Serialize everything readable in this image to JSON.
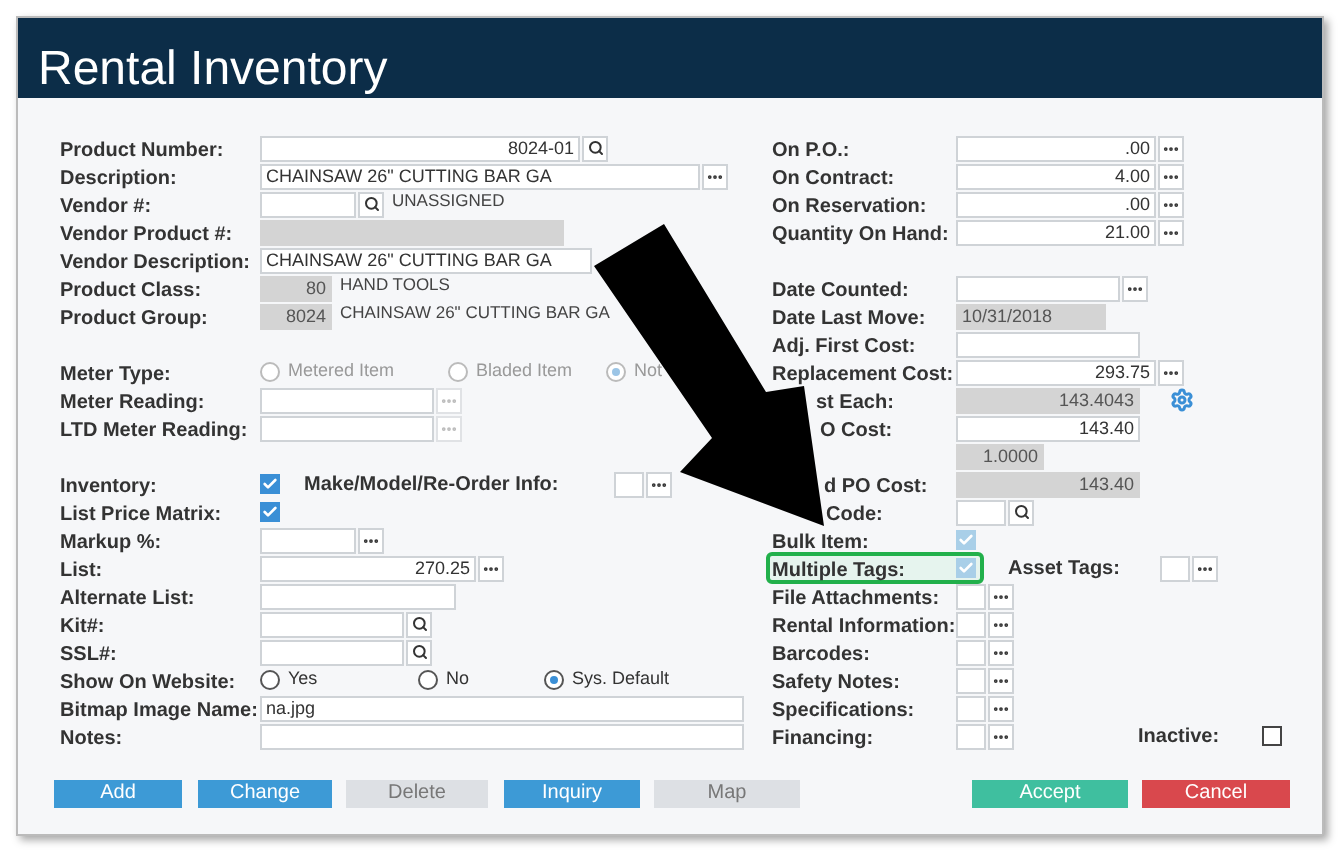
{
  "window": {
    "title": "Rental Inventory"
  },
  "left_sections": [
    [
      {
        "label": "Product Number:",
        "kind": "field",
        "value": "8024-01",
        "numeric": true,
        "button": {
          "kind": "search"
        }
      },
      {
        "label": "Description:",
        "kind": "field",
        "value": "CHAINSAW 26\"  CUTTING BAR GA",
        "button": {
          "kind": "more"
        }
      },
      {
        "label": "Vendor #:",
        "kind": "field",
        "button": {
          "kind": "search"
        },
        "note": "UNASSIGNED"
      },
      {
        "label": "Vendor Product #:",
        "kind": "field",
        "readonly": true
      },
      {
        "label": "Vendor Description:",
        "kind": "field",
        "value": "CHAINSAW 26\"  CUTTING BAR GA"
      },
      {
        "label": "Product Class:",
        "kind": "field",
        "value": "80",
        "numeric": true,
        "readonly": true,
        "note": "HAND TOOLS"
      },
      {
        "label": "Product Group:",
        "kind": "field",
        "value": "8024",
        "numeric": true,
        "readonly": true,
        "note": "CHAINSAW 26\" CUTTING BAR GA"
      }
    ],
    [
      {
        "label": "Meter Type:",
        "kind": "radio",
        "options": [
          {
            "label": "Metered Item",
            "selected": false,
            "disabled": true
          },
          {
            "label": "Bladed Item",
            "selected": false,
            "disabled": true
          },
          {
            "label": "Not",
            "selected": true,
            "disabled": true
          }
        ]
      },
      {
        "label": "Meter Reading:",
        "kind": "field",
        "button": {
          "kind": "more_disabled"
        }
      },
      {
        "label": "LTD Meter Reading:",
        "kind": "field",
        "button": {
          "kind": "more_disabled"
        }
      }
    ],
    [
      {
        "label": "Inventory:",
        "kind": "checkbox",
        "checked": true,
        "disabled": false,
        "extra": {
          "label": "Make/Model/Re-Order Info:",
          "kind": "field",
          "button": {
            "kind": "more"
          }
        }
      },
      {
        "label": "List Price Matrix:",
        "kind": "checkbox",
        "checked": true,
        "disabled": false
      },
      {
        "label": "Markup %:",
        "kind": "field",
        "button": {
          "kind": "more"
        }
      },
      {
        "label": "List:",
        "kind": "field",
        "value": "270.25",
        "numeric": true,
        "button": {
          "kind": "more"
        }
      },
      {
        "label": "Alternate List:",
        "kind": "field"
      },
      {
        "label": "Kit#:",
        "kind": "field",
        "button": {
          "kind": "search"
        }
      },
      {
        "label": "SSL#:",
        "kind": "field",
        "button": {
          "kind": "search"
        }
      },
      {
        "label": "Show On Website:",
        "kind": "radio",
        "options": [
          {
            "label": "Yes",
            "selected": false,
            "disabled": false
          },
          {
            "label": "No",
            "selected": false,
            "disabled": false
          },
          {
            "label": "Sys. Default",
            "selected": true,
            "disabled": false
          }
        ]
      },
      {
        "label": "Bitmap Image Name:",
        "kind": "field",
        "value": "na.jpg"
      },
      {
        "label": "Notes:",
        "kind": "field"
      }
    ]
  ],
  "right_sections": [
    [
      {
        "label": "On P.O.:",
        "kind": "field",
        "value": ".00",
        "numeric": true,
        "button": {
          "kind": "more"
        }
      },
      {
        "label": "On Contract:",
        "kind": "field",
        "value": "4.00",
        "numeric": true,
        "button": {
          "kind": "more"
        }
      },
      {
        "label": "On Reservation:",
        "kind": "field",
        "value": ".00",
        "numeric": true,
        "button": {
          "kind": "more"
        }
      },
      {
        "label": "Quantity On Hand:",
        "kind": "field",
        "value": "21.00",
        "numeric": true,
        "button": {
          "kind": "more"
        }
      }
    ],
    [
      {
        "label": "Date Counted:",
        "kind": "field",
        "button": {
          "kind": "more"
        }
      },
      {
        "label": "Date Last Move:",
        "kind": "field",
        "value": "10/31/2018",
        "readonly": true
      },
      {
        "label": "Adj. First Cost:",
        "kind": "field"
      },
      {
        "label": "Replacement Cost:",
        "kind": "field",
        "value": "293.75",
        "numeric": true,
        "button": {
          "kind": "more"
        }
      },
      {
        "label": "st Each:",
        "kind": "field",
        "value": "143.4043",
        "numeric": true,
        "readonly": true,
        "button": {
          "kind": "gear"
        }
      },
      {
        "label": "O Cost:",
        "kind": "field",
        "value": "143.40",
        "numeric": true
      },
      {
        "kind": "field",
        "value": "1.0000",
        "numeric": true,
        "readonly": true
      },
      {
        "label": "d PO Cost:",
        "kind": "field",
        "value": "143.40",
        "numeric": true,
        "readonly": true
      },
      {
        "label": "Code:",
        "kind": "field",
        "button": {
          "kind": "search"
        }
      },
      {
        "label": "Bulk Item:",
        "kind": "checkbox",
        "checked": true,
        "disabled": true
      },
      {
        "label": "Multiple Tags:",
        "kind": "checkbox",
        "checked": true,
        "disabled": true,
        "highlighted": true,
        "extra": {
          "label": "Asset Tags:",
          "kind": "field",
          "button": {
            "kind": "more"
          }
        }
      },
      {
        "label": "File Attachments:",
        "kind": "field",
        "button": {
          "kind": "more"
        }
      },
      {
        "label": "Rental Information:",
        "kind": "field",
        "button": {
          "kind": "more"
        }
      },
      {
        "label": "Barcodes:",
        "kind": "field",
        "button": {
          "kind": "more"
        }
      },
      {
        "label": "Safety Notes:",
        "kind": "field",
        "button": {
          "kind": "more"
        }
      },
      {
        "label": "Specifications:",
        "kind": "field",
        "button": {
          "kind": "more"
        }
      },
      {
        "label": "Financing:",
        "kind": "field",
        "button": {
          "kind": "more"
        },
        "extra": {
          "label": "Inactive:",
          "kind": "checkbox",
          "checked": false,
          "disabled": false
        }
      }
    ]
  ],
  "buttons": [
    {
      "label": "Add",
      "kind": "primary"
    },
    {
      "label": "Change",
      "kind": "primary"
    },
    {
      "label": "Delete",
      "kind": "disabled"
    },
    {
      "label": "Inquiry",
      "kind": "primary"
    },
    {
      "label": "Map",
      "kind": "disabled"
    },
    {
      "label": "Accept",
      "kind": "accept"
    },
    {
      "label": "Cancel",
      "kind": "cancel"
    }
  ]
}
